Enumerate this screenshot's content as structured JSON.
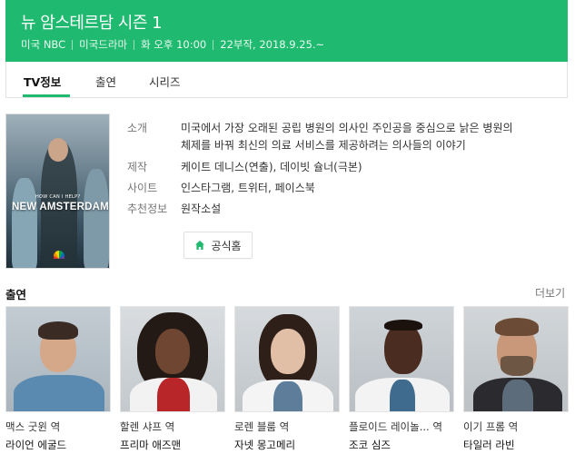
{
  "header": {
    "title": "뉴 암스테르담 시즌 1",
    "meta": [
      "미국 NBC",
      "미국드라마",
      "화 오후 10:00",
      "22부작, 2018.9.25.~"
    ],
    "bg_color": "#1fb96f"
  },
  "tabs": [
    {
      "label": "TV정보",
      "active": true
    },
    {
      "label": "출연",
      "active": false
    },
    {
      "label": "시리즈",
      "active": false
    }
  ],
  "poster": {
    "tagline": "HOW CAN I HELP?",
    "title": "NEW AMSTERDAM"
  },
  "info": {
    "intro_label": "소개",
    "intro_line1": "미국에서 가장 오래된 공립 병원의 의사인 주인공을 중심으로 낡은 병원의",
    "intro_line2": "체제를 바꿔 최신의 의료 서비스를 제공하려는 의사들의 이야기",
    "production_label": "제작",
    "production_links": [
      "케이트 데니스(연출)",
      "데이빗 슐너(극본)"
    ],
    "site_label": "사이트",
    "site_links": [
      "인스타그램",
      "트위터",
      "페이스북"
    ],
    "recommend_label": "추천정보",
    "recommend_value": "원작소설",
    "homepage_button": "공식홈"
  },
  "cast_section": {
    "heading": "출연",
    "more": "더보기",
    "members": [
      {
        "role": "맥스 굿윈 역",
        "actor": "라이언 에굴드"
      },
      {
        "role": "할렌 샤프 역",
        "actor": "프리마 애즈맨"
      },
      {
        "role": "로렌 블룸 역",
        "actor": "자넷 몽고메리"
      },
      {
        "role": "플로이드 레이놀... 역",
        "actor": "조코 심즈"
      },
      {
        "role": "이기 프롬 역",
        "actor": "타일러 라빈"
      }
    ]
  }
}
